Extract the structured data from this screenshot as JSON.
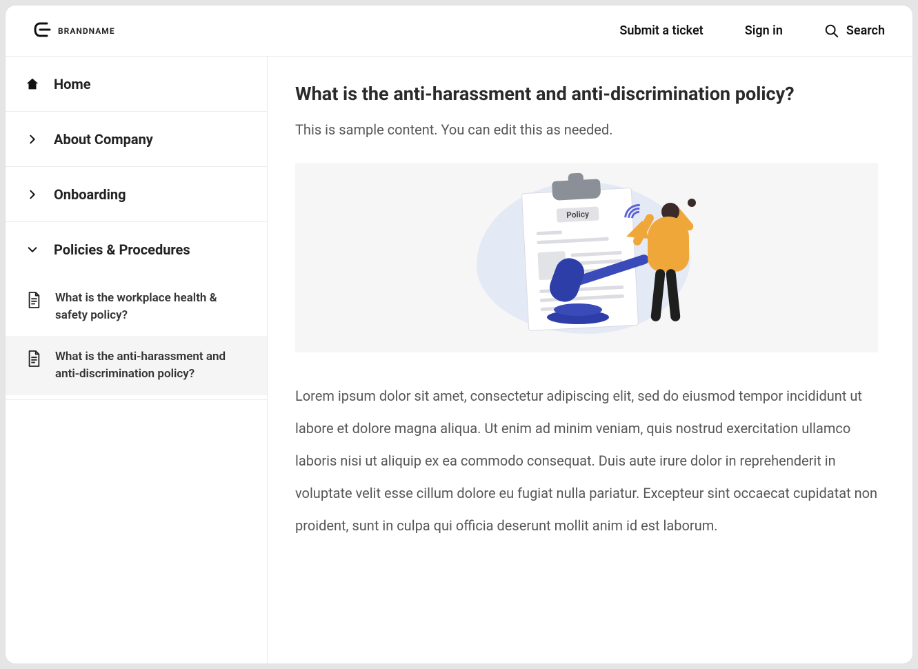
{
  "header": {
    "brand": "BRANDNAME",
    "submit": "Submit a ticket",
    "signin": "Sign in",
    "search": "Search"
  },
  "sidebar": {
    "home": "Home",
    "about": "About Company",
    "onboarding": "Onboarding",
    "policies": "Policies & Procedures",
    "articles": [
      {
        "label": "What is the workplace health & safety policy?"
      },
      {
        "label": "What is the anti-harassment and anti-discrimination policy?"
      }
    ]
  },
  "article": {
    "title": "What is the anti-harassment and anti-discrimination policy?",
    "intro": "This is sample content. You can edit this as needed.",
    "hero_tag": "Policy",
    "body": "Lorem ipsum dolor sit amet, consectetur adipiscing elit, sed do eiusmod tempor incididunt ut labore et dolore magna aliqua. Ut enim ad minim veniam, quis nostrud exercitation ullamco laboris nisi ut aliquip ex ea commodo consequat. Duis aute irure dolor in reprehenderit in voluptate velit esse cillum dolore eu fugiat nulla pariatur. Excepteur sint occaecat cupidatat non proident, sunt in culpa qui officia deserunt mollit anim id est laborum."
  }
}
